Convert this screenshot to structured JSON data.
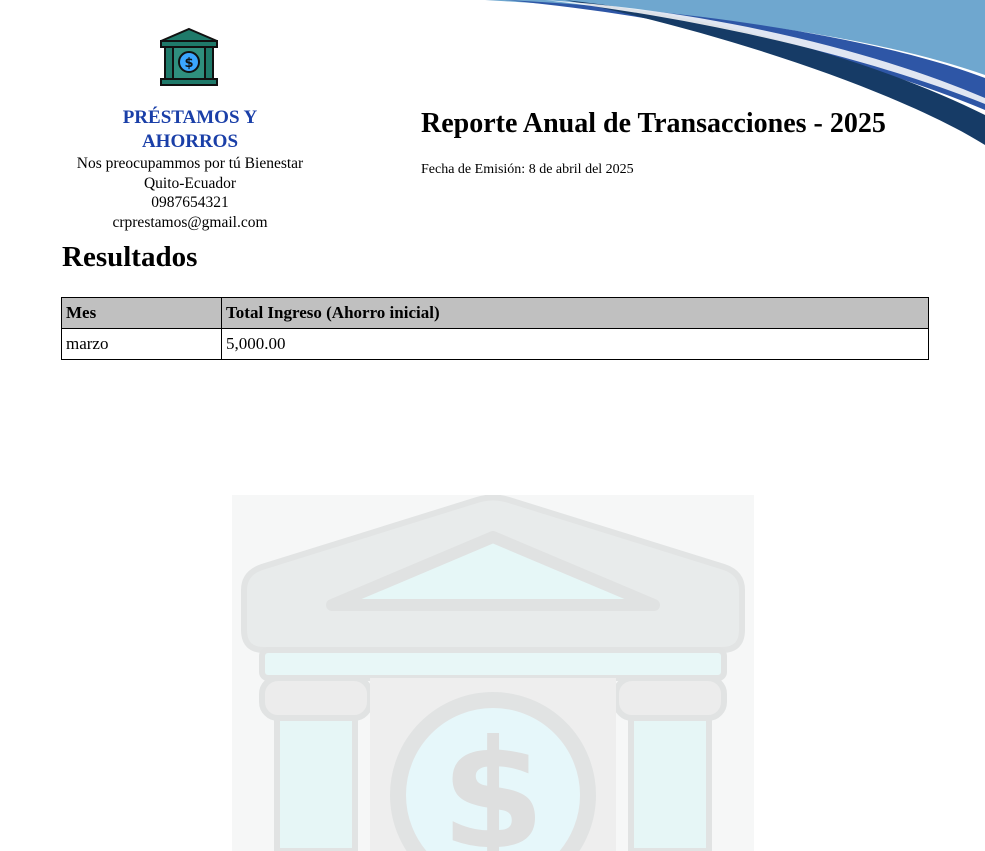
{
  "company": {
    "logo_icon": "bank-dollar-icon",
    "name": "PRÉSTAMOS Y AHORROS",
    "tagline": "Nos preocupammos por tú Bienestar",
    "location": "Quito-Ecuador",
    "phone": "0987654321",
    "email": "crprestamos@gmail.com",
    "brand_color": "#1a3fa8"
  },
  "report": {
    "title": "Reporte Anual de Transacciones - 2025",
    "emission": "Fecha de Emisión: 8 de abril del 2025"
  },
  "results": {
    "heading": "Resultados",
    "columns": [
      "Mes",
      "Total Ingreso (Ahorro inicial)"
    ],
    "rows": [
      [
        "marzo",
        "5,000.00"
      ]
    ],
    "header_bg": "#c0c0c0"
  },
  "decor": {
    "wave_colors": [
      "#6fa7cf",
      "#2e56a6",
      "#163b66"
    ],
    "watermark_icon": "bank-dollar-watermark"
  }
}
